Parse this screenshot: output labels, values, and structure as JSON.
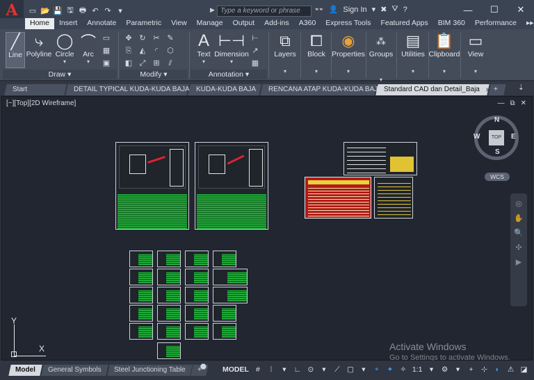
{
  "app": {
    "logo_letter": "A",
    "brand_color": "#e5322d"
  },
  "titlebar": {
    "search_placeholder": "Type a keyword or phrase",
    "sign_in": "Sign In",
    "window_controls": {
      "minimize": "—",
      "maximize": "☐",
      "close": "✕"
    }
  },
  "ribbon_tabs": [
    "Home",
    "Insert",
    "Annotate",
    "Parametric",
    "View",
    "Manage",
    "Output",
    "Add-ins",
    "A360",
    "Express Tools",
    "Featured Apps",
    "BIM 360",
    "Performance"
  ],
  "ribbon": {
    "draw": {
      "line": "Line",
      "polyline": "Polyline",
      "circle": "Circle",
      "arc": "Arc",
      "panel": "Draw"
    },
    "modify": {
      "panel": "Modify"
    },
    "annotation": {
      "text": "Text",
      "dimension": "Dimension",
      "panel": "Annotation"
    },
    "layers": "Layers",
    "block": "Block",
    "properties": "Properties",
    "groups": "Groups",
    "utilities": "Utilities",
    "clipboard": "Clipboard",
    "view": "View"
  },
  "doc_tabs": [
    {
      "label": "Start",
      "active": false,
      "closable": false
    },
    {
      "label": "DETAIL TYPICAL KUDA-KUDA BAJA",
      "active": false,
      "closable": true
    },
    {
      "label": "KUDA-KUDA BAJA",
      "active": false,
      "closable": true
    },
    {
      "label": "RENCANA ATAP KUDA-KUDA BAJA",
      "active": false,
      "closable": true
    },
    {
      "label": "Standard CAD dan Detail_Baja",
      "active": true,
      "closable": true
    }
  ],
  "viewport": {
    "label": "[−][Top][2D Wireframe]",
    "viewcube": {
      "north": "N",
      "south": "S",
      "east": "E",
      "west": "W",
      "face": "TOP"
    },
    "wcs": "WCS",
    "ucs_x": "X",
    "ucs_y": "Y"
  },
  "watermark": {
    "title": "Activate Windows",
    "subtitle": "Go to Settings to activate Windows."
  },
  "layout_tabs": [
    {
      "label": "Model",
      "active": true
    },
    {
      "label": "General Symbols",
      "active": false
    },
    {
      "label": "Steel Junctioning Table",
      "active": false
    }
  ],
  "statusbar": {
    "model": "MODEL",
    "scale": "1:1"
  }
}
